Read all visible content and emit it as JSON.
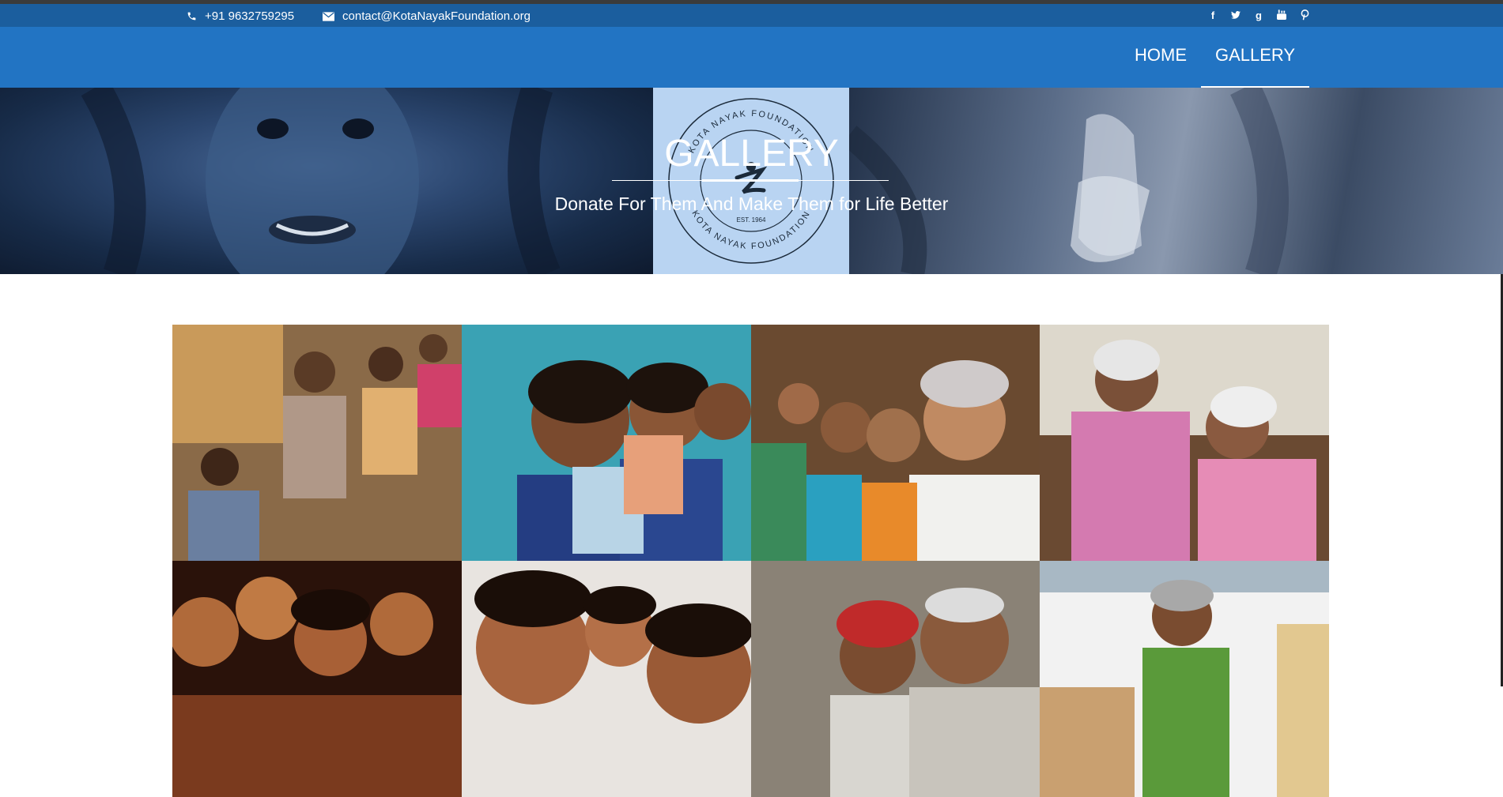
{
  "contact": {
    "phone": "+91 9632759295",
    "email": "contact@KotaNayakFoundation.org"
  },
  "social": [
    "facebook-icon",
    "twitter-icon",
    "google-plus-icon",
    "youtube-icon",
    "pinterest-icon"
  ],
  "nav": {
    "home": "HOME",
    "gallery": "GALLERY"
  },
  "hero": {
    "title": "GALLERY",
    "subtitle": "Donate For Them And Make Them for Life Better"
  },
  "logo": {
    "ring_text_top": "KOTA NAYAK FOUNDATION",
    "ring_text_bottom": "KOTA NAYAK FOUNDATION",
    "est": "EST. 1964"
  },
  "colors": {
    "topbar": "#1b5e9e",
    "navbar": "#2274c3"
  },
  "gallery": [
    {
      "name": "children-wheelchairs-photo"
    },
    {
      "name": "schoolgirls-books-photo"
    },
    {
      "name": "elderly-women-group-photo"
    },
    {
      "name": "two-elderly-women-photo"
    },
    {
      "name": "young-children-photo"
    },
    {
      "name": "smiling-boys-photo"
    },
    {
      "name": "elderly-men-photo"
    },
    {
      "name": "elderly-woman-green-sari-photo"
    }
  ]
}
